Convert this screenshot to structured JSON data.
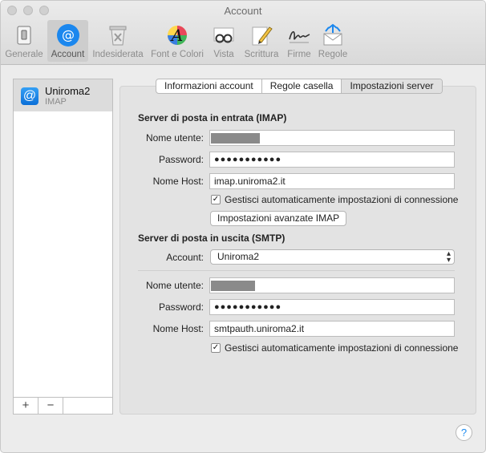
{
  "window": {
    "title": "Account"
  },
  "toolbar": {
    "items": [
      {
        "label": "Generale",
        "icon": "switch-icon"
      },
      {
        "label": "Account",
        "icon": "at-sign-icon"
      },
      {
        "label": "Indesiderata",
        "icon": "trash-icon"
      },
      {
        "label": "Font e Colori",
        "icon": "font-colors-icon"
      },
      {
        "label": "Vista",
        "icon": "glasses-icon"
      },
      {
        "label": "Scrittura",
        "icon": "pencil-icon"
      },
      {
        "label": "Firme",
        "icon": "signature-icon"
      },
      {
        "label": "Regole",
        "icon": "rules-envelope-icon"
      }
    ],
    "active_index": 1
  },
  "sidebar": {
    "accounts": [
      {
        "name": "Uniroma2",
        "type": "IMAP",
        "icon": "at-sign-icon"
      }
    ],
    "add_label": "+",
    "remove_label": "−"
  },
  "tabs": {
    "items": [
      "Informazioni account",
      "Regole casella",
      "Impostazioni server"
    ],
    "selected_index": 2
  },
  "incoming": {
    "title": "Server di posta in entrata (IMAP)",
    "username_label": "Nome utente:",
    "username_value": "",
    "password_label": "Password:",
    "password_value": "●●●●●●●●●●●",
    "host_label": "Nome Host:",
    "host_value": "imap.uniroma2.it",
    "auto_manage_label": "Gestisci automaticamente impostazioni di connessione",
    "auto_manage_checked": true,
    "advanced_button": "Impostazioni avanzate IMAP"
  },
  "outgoing": {
    "title": "Server di posta in uscita (SMTP)",
    "account_label": "Account:",
    "account_value": "Uniroma2",
    "username_label": "Nome utente:",
    "username_value": "",
    "password_label": "Password:",
    "password_value": "●●●●●●●●●●●",
    "host_label": "Nome Host:",
    "host_value": "smtpauth.uniroma2.it",
    "auto_manage_label": "Gestisci automaticamente impostazioni di connessione",
    "auto_manage_checked": true
  },
  "help": {
    "label": "?"
  },
  "colors": {
    "accent": "#1e8cf0",
    "toolbar_active": "#cdcdcd",
    "panel": "#e3e3e3"
  }
}
